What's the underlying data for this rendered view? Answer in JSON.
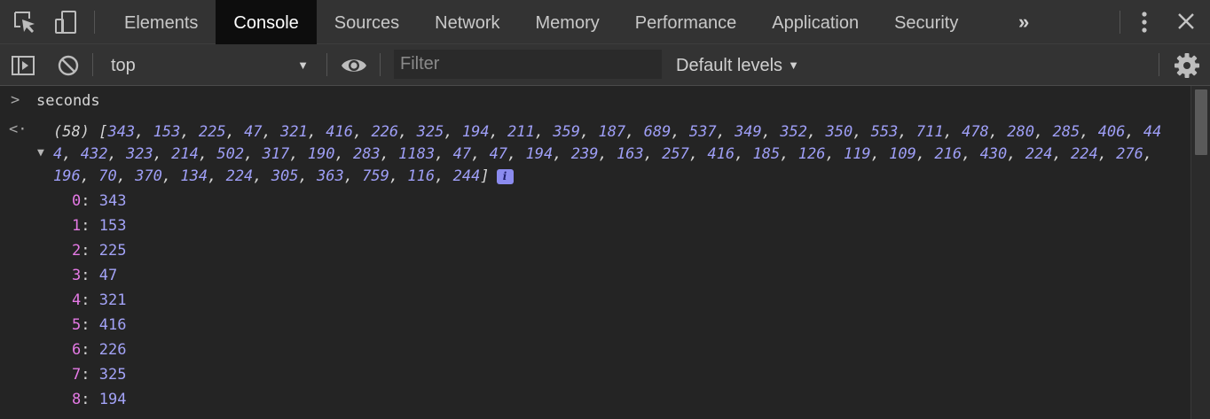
{
  "tabbar": {
    "tabs": [
      {
        "label": "Elements"
      },
      {
        "label": "Console"
      },
      {
        "label": "Sources"
      },
      {
        "label": "Network"
      },
      {
        "label": "Memory"
      },
      {
        "label": "Performance"
      },
      {
        "label": "Application"
      },
      {
        "label": "Security"
      }
    ],
    "active_tab": "Console",
    "more_glyph": "»"
  },
  "toolbar": {
    "context_value": "top",
    "filter_placeholder": "Filter",
    "levels_label": "Default levels"
  },
  "console": {
    "command": "seconds",
    "array_length_label": "(58)",
    "array_values": [
      343,
      153,
      225,
      47,
      321,
      416,
      226,
      325,
      194,
      211,
      359,
      187,
      689,
      537,
      349,
      352,
      350,
      553,
      711,
      478,
      280,
      285,
      406,
      444,
      432,
      323,
      214,
      502,
      317,
      190,
      283,
      1183,
      47,
      47,
      194,
      239,
      163,
      257,
      416,
      185,
      126,
      119,
      109,
      216,
      430,
      224,
      224,
      276,
      196,
      70,
      370,
      134,
      224,
      305,
      363,
      759,
      116,
      244
    ],
    "info_badge": "i",
    "expanded_items": [
      {
        "key": "0",
        "value": "343"
      },
      {
        "key": "1",
        "value": "153"
      },
      {
        "key": "2",
        "value": "225"
      },
      {
        "key": "3",
        "value": "47"
      },
      {
        "key": "4",
        "value": "321"
      },
      {
        "key": "5",
        "value": "416"
      },
      {
        "key": "6",
        "value": "226"
      },
      {
        "key": "7",
        "value": "325"
      },
      {
        "key": "8",
        "value": "194"
      }
    ]
  },
  "colors": {
    "panel_bg": "#242424",
    "toolbar_bg": "#333333",
    "active_tab_bg": "#0d0d0d",
    "array_value": "#9f9ff7",
    "index_key": "#e57ae5"
  }
}
